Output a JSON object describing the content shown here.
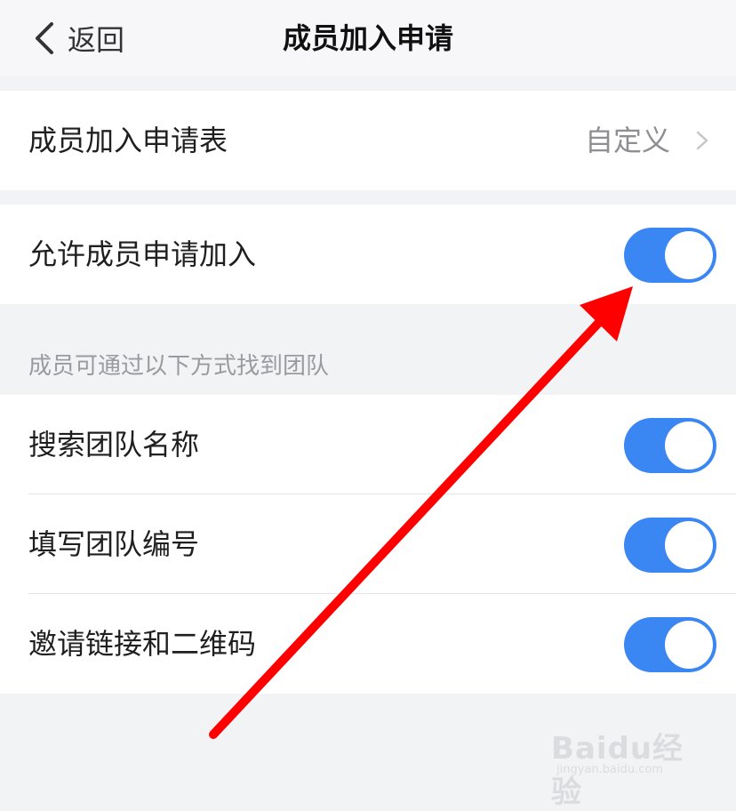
{
  "header": {
    "back_label": "返回",
    "title": "成员加入申请"
  },
  "application_form": {
    "label": "成员加入申请表",
    "value": "自定义"
  },
  "allow_apply": {
    "label": "允许成员申请加入",
    "enabled": true
  },
  "discovery": {
    "caption": "成员可通过以下方式找到团队",
    "items": [
      {
        "label": "搜索团队名称",
        "enabled": true
      },
      {
        "label": "填写团队编号",
        "enabled": true
      },
      {
        "label": "邀请链接和二维码",
        "enabled": true
      }
    ]
  },
  "annotation": {
    "color": "#ff0000",
    "icon": "red-arrow"
  },
  "colors": {
    "toggle_on": "#3a86f2",
    "page_bg": "#f2f3f5"
  },
  "watermark": {
    "brand": "Baidu经验",
    "sub": "jingyan.baidu.com"
  }
}
